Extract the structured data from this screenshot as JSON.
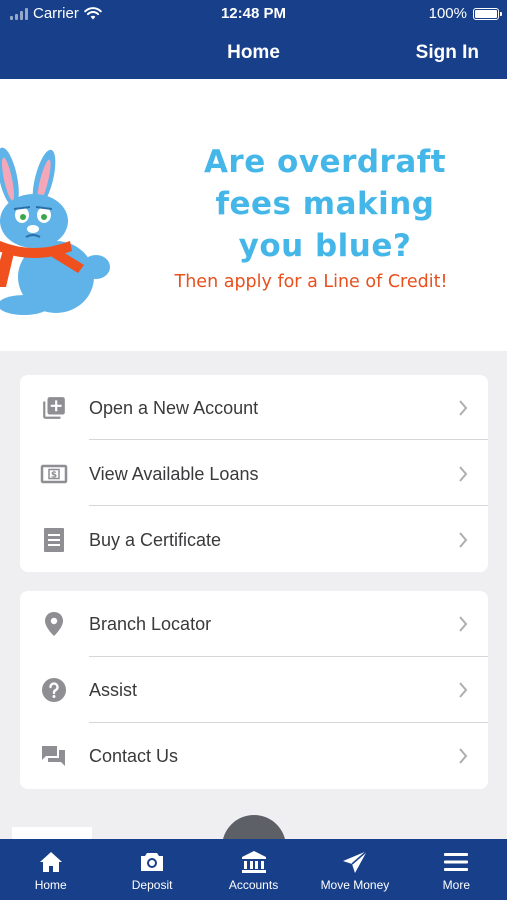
{
  "status_bar": {
    "carrier": "Carrier",
    "time": "12:48 PM",
    "battery": "100%"
  },
  "nav": {
    "title": "Home",
    "sign_in": "Sign In"
  },
  "banner": {
    "headline_line1": "Are overdraft",
    "headline_line2": "fees making",
    "headline_line3": "you blue?",
    "subline": "Then apply for a Line of Credit!",
    "headline_color": "#45b6e8",
    "subline_color": "#e8501d"
  },
  "menu_group_1": [
    {
      "label": "Open a New Account",
      "icon": "add-box-icon"
    },
    {
      "label": "View Available Loans",
      "icon": "money-icon"
    },
    {
      "label": "Buy a Certificate",
      "icon": "certificate-icon"
    }
  ],
  "menu_group_2": [
    {
      "label": "Branch Locator",
      "icon": "location-pin-icon"
    },
    {
      "label": "Assist",
      "icon": "help-icon"
    },
    {
      "label": "Contact Us",
      "icon": "chat-icon"
    }
  ],
  "tab_bar": [
    {
      "label": "Home",
      "icon": "home-icon"
    },
    {
      "label": "Deposit",
      "icon": "camera-icon"
    },
    {
      "label": "Accounts",
      "icon": "bank-icon"
    },
    {
      "label": "Move Money",
      "icon": "send-icon"
    },
    {
      "label": "More",
      "icon": "menu-icon"
    }
  ],
  "colors": {
    "brand": "#173f8a",
    "background": "#efeff2",
    "icon_gray": "#8e8e93"
  }
}
